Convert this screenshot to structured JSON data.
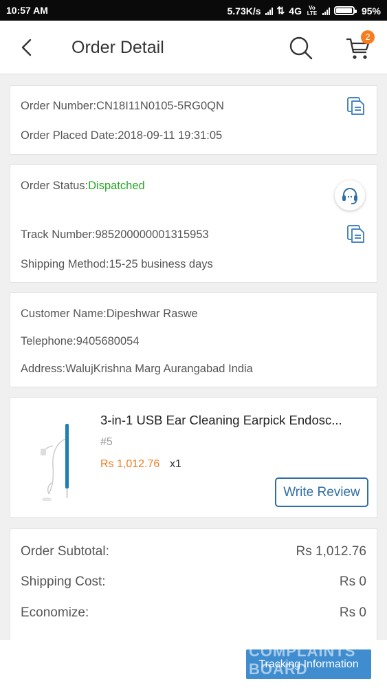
{
  "status_bar": {
    "time": "10:57 AM",
    "speed": "5.73K/s",
    "network": "4G",
    "volte": "Vo LTE",
    "battery": "95%"
  },
  "header": {
    "title": "Order Detail",
    "cart_count": "2"
  },
  "order": {
    "number_label": "Order Number:",
    "number": "CN18I11N0105-5RG0QN",
    "date_label": "Order Placed Date:",
    "date": "2018-09-11 19:31:05"
  },
  "shipment": {
    "status_label": "Order Status:",
    "status": "Dispatched",
    "track_label": "Track Number:",
    "track": "985200000001315953",
    "method_label": "Shipping Method:",
    "method": "15-25 business days"
  },
  "customer": {
    "name_label": "Customer Name:",
    "name": "Dipeshwar Raswe",
    "phone_label": "Telephone:",
    "phone": "9405680054",
    "address_label": "Address:",
    "address": "WalujKrishna Marg Aurangabad India"
  },
  "product": {
    "name": "3-in-1 USB Ear Cleaning Earpick Endosc...",
    "variant": "#5",
    "price": "Rs 1,012.76",
    "qty": "x1",
    "review_label": "Write Review"
  },
  "summary": {
    "subtotal_label": "Order Subtotal:",
    "subtotal": "Rs 1,012.76",
    "shipping_label": "Shipping Cost:",
    "shipping": "Rs 0",
    "economize_label": "Economize:",
    "economize": "Rs 0"
  },
  "footer": {
    "tracking_label": "Tracking Information",
    "watermark": "COMPLAINTS BOARD"
  },
  "colors": {
    "accent_blue": "#3f8ccf",
    "status_green": "#26a826",
    "price_orange": "#f07b1f"
  }
}
